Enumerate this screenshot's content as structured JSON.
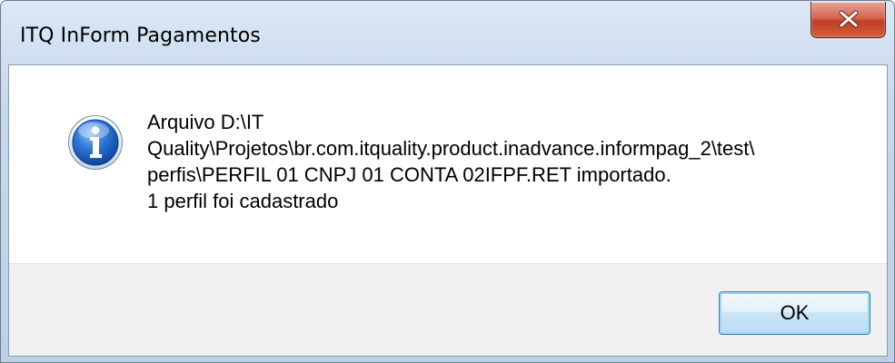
{
  "window": {
    "title": "ITQ InForm Pagamentos",
    "close_icon": "close-icon"
  },
  "dialog": {
    "icon": "info-icon",
    "message_lines": [
      "Arquivo D:\\IT",
      "Quality\\Projetos\\br.com.itquality.product.inadvance.informpag_2\\test\\",
      "perfis\\PERFIL 01 CNPJ 01 CONTA 02IFPF.RET importado.",
      "1 perfil foi cadastrado"
    ],
    "ok_label": "OK"
  },
  "colors": {
    "close_button": "#c7452b",
    "ok_border": "#3c7fb1",
    "footer_bg": "#f0f0f0"
  }
}
